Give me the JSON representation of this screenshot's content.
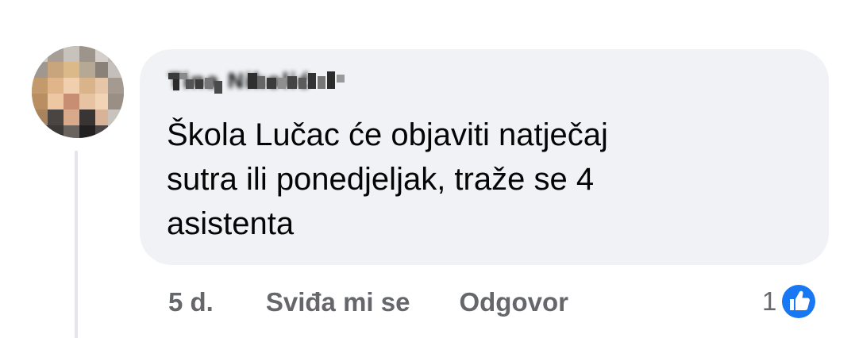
{
  "comment": {
    "author": "Tina Nikolić",
    "text_lines": [
      "Škola Lučac će objaviti natječaj",
      "sutra ili ponedjeljak, traže  se 4",
      "asistenta"
    ],
    "time": "5 d.",
    "like_label": "Sviđa mi se",
    "reply_label": "Odgovor",
    "reaction_count": "1",
    "reaction_icon": "like-thumb-icon"
  },
  "colors": {
    "bubble": "#f0f2f5",
    "text": "#050505",
    "secondary_text": "#65676b",
    "like_blue": "#1877f2",
    "thread_line": "#e4e6eb"
  }
}
